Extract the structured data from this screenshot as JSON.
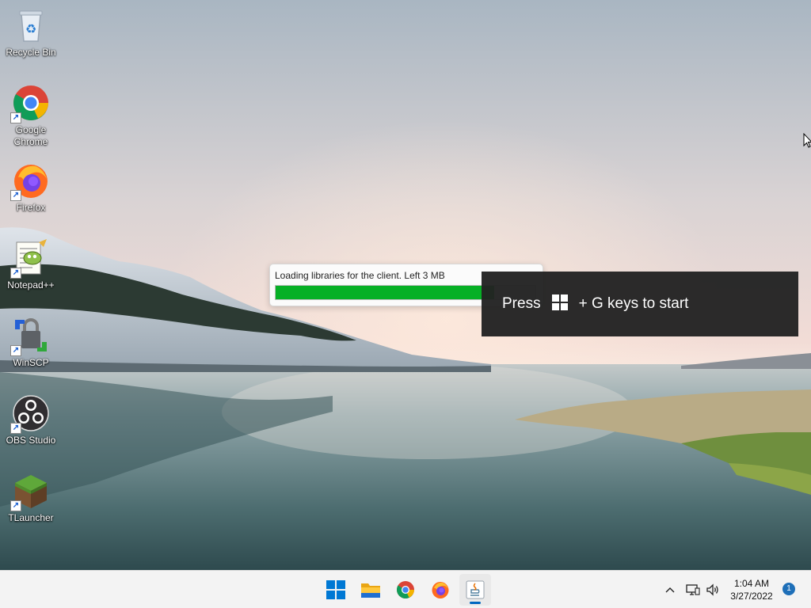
{
  "desktop": {
    "icons": [
      {
        "label": "Recycle Bin",
        "icon": "recycle-bin-icon"
      },
      {
        "label": "Google Chrome",
        "icon": "chrome-icon"
      },
      {
        "label": "Firefox",
        "icon": "firefox-icon"
      },
      {
        "label": "Notepad++",
        "icon": "notepadpp-icon"
      },
      {
        "label": "WinSCP",
        "icon": "winscp-icon"
      },
      {
        "label": "OBS Studio",
        "icon": "obs-icon"
      },
      {
        "label": "TLauncher",
        "icon": "tlauncher-icon"
      }
    ]
  },
  "loader": {
    "message": "Loading libraries for the client. Left 3 MB",
    "progress_fraction": 0.84,
    "bar_color": "#06b025"
  },
  "gamebar_hint": {
    "prefix": "Press",
    "suffix": "+ G keys to start",
    "key_icon": "windows-logo-icon"
  },
  "taskbar": {
    "apps": [
      {
        "name": "start",
        "icon": "windows-start-icon",
        "active": false
      },
      {
        "name": "file-explorer",
        "icon": "folder-icon",
        "active": false
      },
      {
        "name": "chrome",
        "icon": "chrome-icon",
        "active": false
      },
      {
        "name": "firefox",
        "icon": "firefox-icon",
        "active": false
      },
      {
        "name": "java",
        "icon": "java-icon",
        "active": true
      }
    ],
    "tray_icons": [
      "chevron-up-icon",
      "network-icon",
      "volume-icon"
    ],
    "time": "1:04 AM",
    "date": "3/27/2022",
    "notification_count": "1",
    "accent": "#0067c0"
  }
}
